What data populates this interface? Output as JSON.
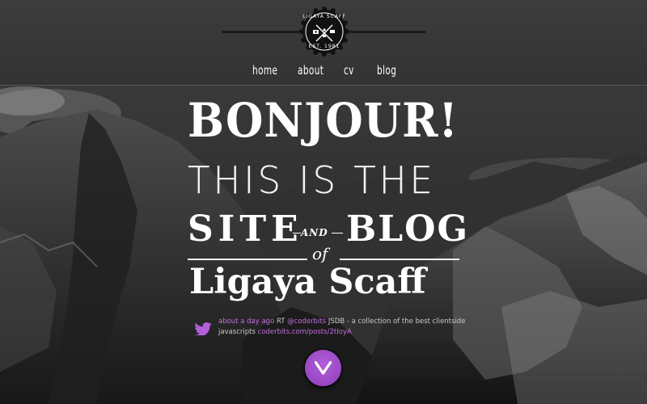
{
  "logo": {
    "name": "LIGAYA SCAFF",
    "established": "EST. 1981"
  },
  "nav": {
    "items": [
      {
        "label": "home"
      },
      {
        "label": "about"
      },
      {
        "label": "cv"
      },
      {
        "label": "blog"
      }
    ]
  },
  "headline": {
    "line1": "BONJOUR!",
    "line2": "THIS IS THE",
    "site": "SITE",
    "and": "AND",
    "blog": "BLOG",
    "of": "of",
    "name": "Ligaya Scaff"
  },
  "tweet": {
    "time": "about a day ago",
    "rt": "RT",
    "handle": "@coderbits",
    "text": "JSDB - a collection of the best clientside javascripts",
    "link": "coderbits.com/posts/2tIoyA"
  },
  "colors": {
    "accent": "#a54ccf",
    "link": "#c46fe0",
    "header_bg": "#383838"
  },
  "icons": {
    "bird": "twitter-bird-icon",
    "down": "chevron-down-icon"
  }
}
